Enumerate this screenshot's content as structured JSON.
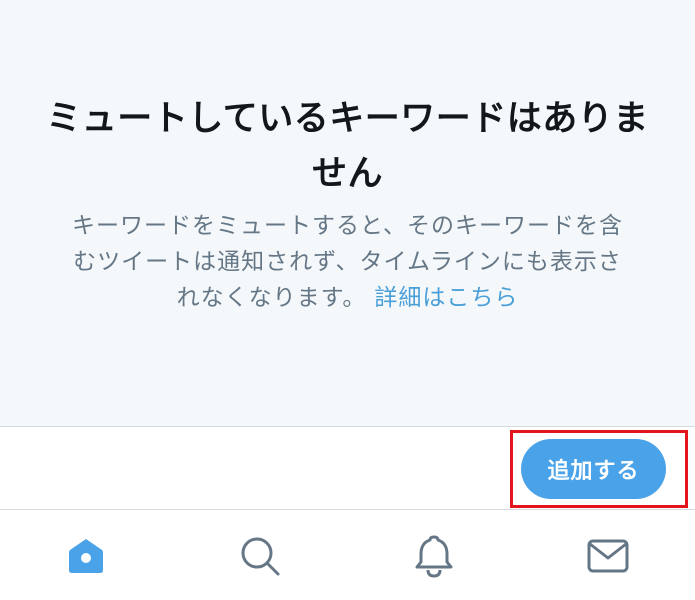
{
  "empty_state": {
    "title": "ミュートしているキーワードはありません",
    "body": "キーワードをミュートすると、そのキーワードを含むツイートは通知されず、タイムラインにも表示されなくなります。",
    "learn_more": "詳細はこちら"
  },
  "action_bar": {
    "add_button_label": "追加する"
  },
  "tab_bar": {
    "tabs": [
      {
        "icon": "home-icon",
        "active": true
      },
      {
        "icon": "search-icon",
        "active": false
      },
      {
        "icon": "bell-icon",
        "active": false
      },
      {
        "icon": "envelope-icon",
        "active": false
      }
    ]
  },
  "colors": {
    "accent": "#4aa3e8",
    "highlight": "#e3141c",
    "icon_inactive": "#657786"
  }
}
